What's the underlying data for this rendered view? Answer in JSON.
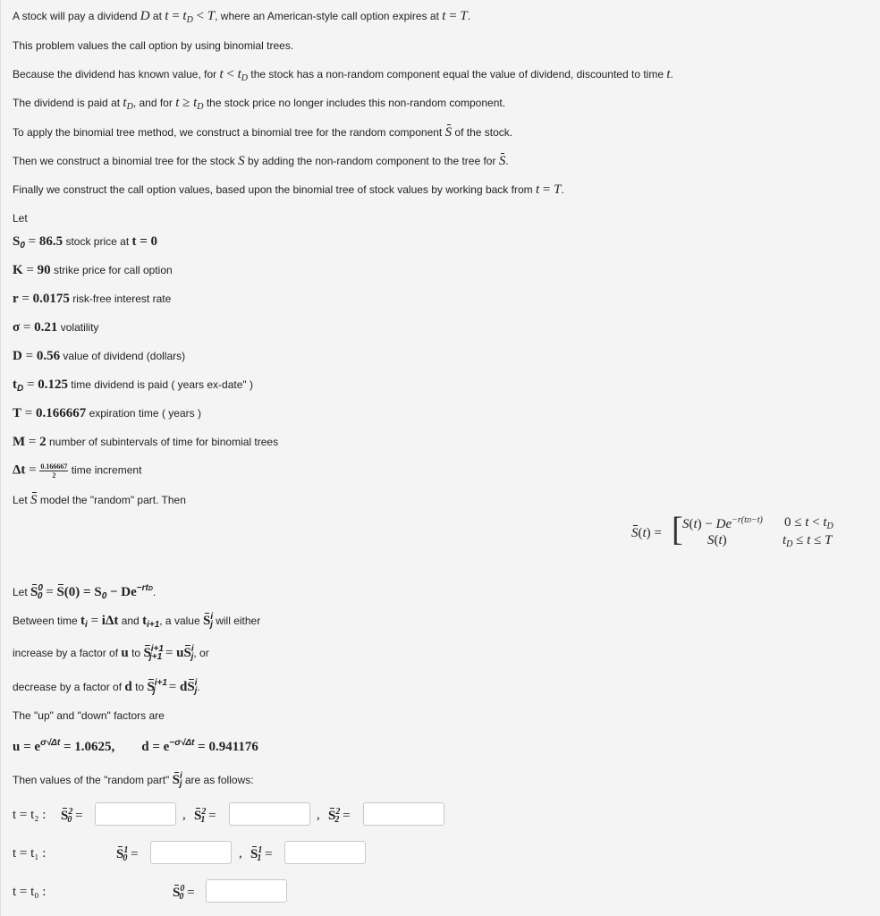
{
  "intro": {
    "line1_a": "A stock will pay a dividend ",
    "line1_b": " at ",
    "line1_c": ", where an American-style call option expires at ",
    "line1_d": ".",
    "line2": "This problem values the call option by using binomial trees.",
    "line3_a": "Because the dividend has known value, for ",
    "line3_b": " the stock has a non-random component equal the value of dividend, discounted to time ",
    "line3_c": ".",
    "line4_a": "The dividend is paid at ",
    "line4_b": ", and for ",
    "line4_c": " the stock price no longer includes this non-random component.",
    "line5_a": "To apply the binomial tree method, we construct a binomial tree for the random component ",
    "line5_b": " of the stock.",
    "line6_a": "Then we construct a binomial tree for the stock ",
    "line6_b": " by adding the non-random component to the tree for ",
    "line6_c": ".",
    "line7_a": "Finally we construct the call option values, based upon the binomial tree of stock values by working back from ",
    "line7_b": ".",
    "let": "Let"
  },
  "math": {
    "D": "D",
    "t_eq_tD_lt_T": "t = t",
    "t_eq_T": "t = T",
    "t_lt_tD": "t < t",
    "t_ge_tD": "t ≥ t",
    "t": "t",
    "S": "S",
    "sub_D": "D"
  },
  "params": [
    {
      "symbol": "S",
      "sub": "0",
      "value": "86.5",
      "desc": " stock price at ",
      "extra": "t = 0"
    },
    {
      "symbol": "K",
      "sub": "",
      "value": "90",
      "desc": " strike price for call option",
      "extra": ""
    },
    {
      "symbol": "r",
      "sub": "",
      "value": "0.0175",
      "desc": " risk-free interest rate",
      "extra": ""
    },
    {
      "symbol": "σ",
      "sub": "",
      "value": "0.21",
      "desc": " volatility",
      "extra": ""
    },
    {
      "symbol": "D",
      "sub": "",
      "value": "0.56",
      "desc": " value of dividend (dollars)",
      "extra": ""
    },
    {
      "symbol": "t",
      "sub": "D",
      "value": "0.125",
      "desc": " time dividend is paid ( years ex-date\" )",
      "extra": ""
    },
    {
      "symbol": "T",
      "sub": "",
      "value": "0.166667",
      "desc": " expiration time ( years )",
      "extra": ""
    },
    {
      "symbol": "M",
      "sub": "",
      "value": "2",
      "desc": " number of subintervals of time for binomial trees",
      "extra": ""
    }
  ],
  "delta_t": {
    "symbol": "Δt",
    "numerator": "0.166667",
    "denominator": "2",
    "desc": " time increment"
  },
  "random_part": {
    "text_a": "Let ",
    "text_b": " model the \"random\" part. Then"
  },
  "piecewise": {
    "lhs": "S̄(t) =",
    "row1_expr": "S(t) − De",
    "row1_exp": "−r(t_D−t)",
    "row1_cond": "0 ≤ t < t_D",
    "row2_expr": "S(t)",
    "row2_cond": "t_D ≤ t ≤ T"
  },
  "steps": {
    "let_s0_a": "Let ",
    "let_s0_expr": "= S̄(0) = S₀ − De",
    "let_s0_exp": "−rt_D",
    "let_s0_end": ".",
    "between_a": "Between time ",
    "between_expr1": "t_i = iΔt",
    "between_b": " and ",
    "between_expr2": "t_{i+1}",
    "between_c": ", a value ",
    "between_d": " will either",
    "increase_a": "increase by a factor of ",
    "increase_u": "u",
    "increase_b": " to ",
    "increase_c": ", or",
    "decrease_a": "decrease by a factor of ",
    "decrease_d": "d",
    "decrease_b": " to ",
    "decrease_c": ".",
    "factors_title": "The \"up\" and \"down\" factors are",
    "u_value": "1.0625,",
    "d_value": "0.941176",
    "values_a": "Then values of the \"random part\" ",
    "values_b": " are as follows:"
  },
  "tree": {
    "rows": [
      {
        "label": "t = t₂ :",
        "cells": [
          {
            "name": "S̄",
            "sup": "2",
            "sub": "0",
            "value": ""
          },
          {
            "name": "S̄",
            "sup": "2",
            "sub": "1",
            "value": ""
          },
          {
            "name": "S̄",
            "sup": "2",
            "sub": "2",
            "value": ""
          }
        ]
      },
      {
        "label": "t = t₁ :",
        "cells": [
          {
            "name": "S̄",
            "sup": "1",
            "sub": "0",
            "value": ""
          },
          {
            "name": "S̄",
            "sup": "1",
            "sub": "1",
            "value": ""
          }
        ]
      },
      {
        "label": "t = t₀ :",
        "cells": [
          {
            "name": "S̄",
            "sup": "0",
            "sub": "0",
            "value": ""
          }
        ]
      }
    ],
    "separator": ","
  }
}
